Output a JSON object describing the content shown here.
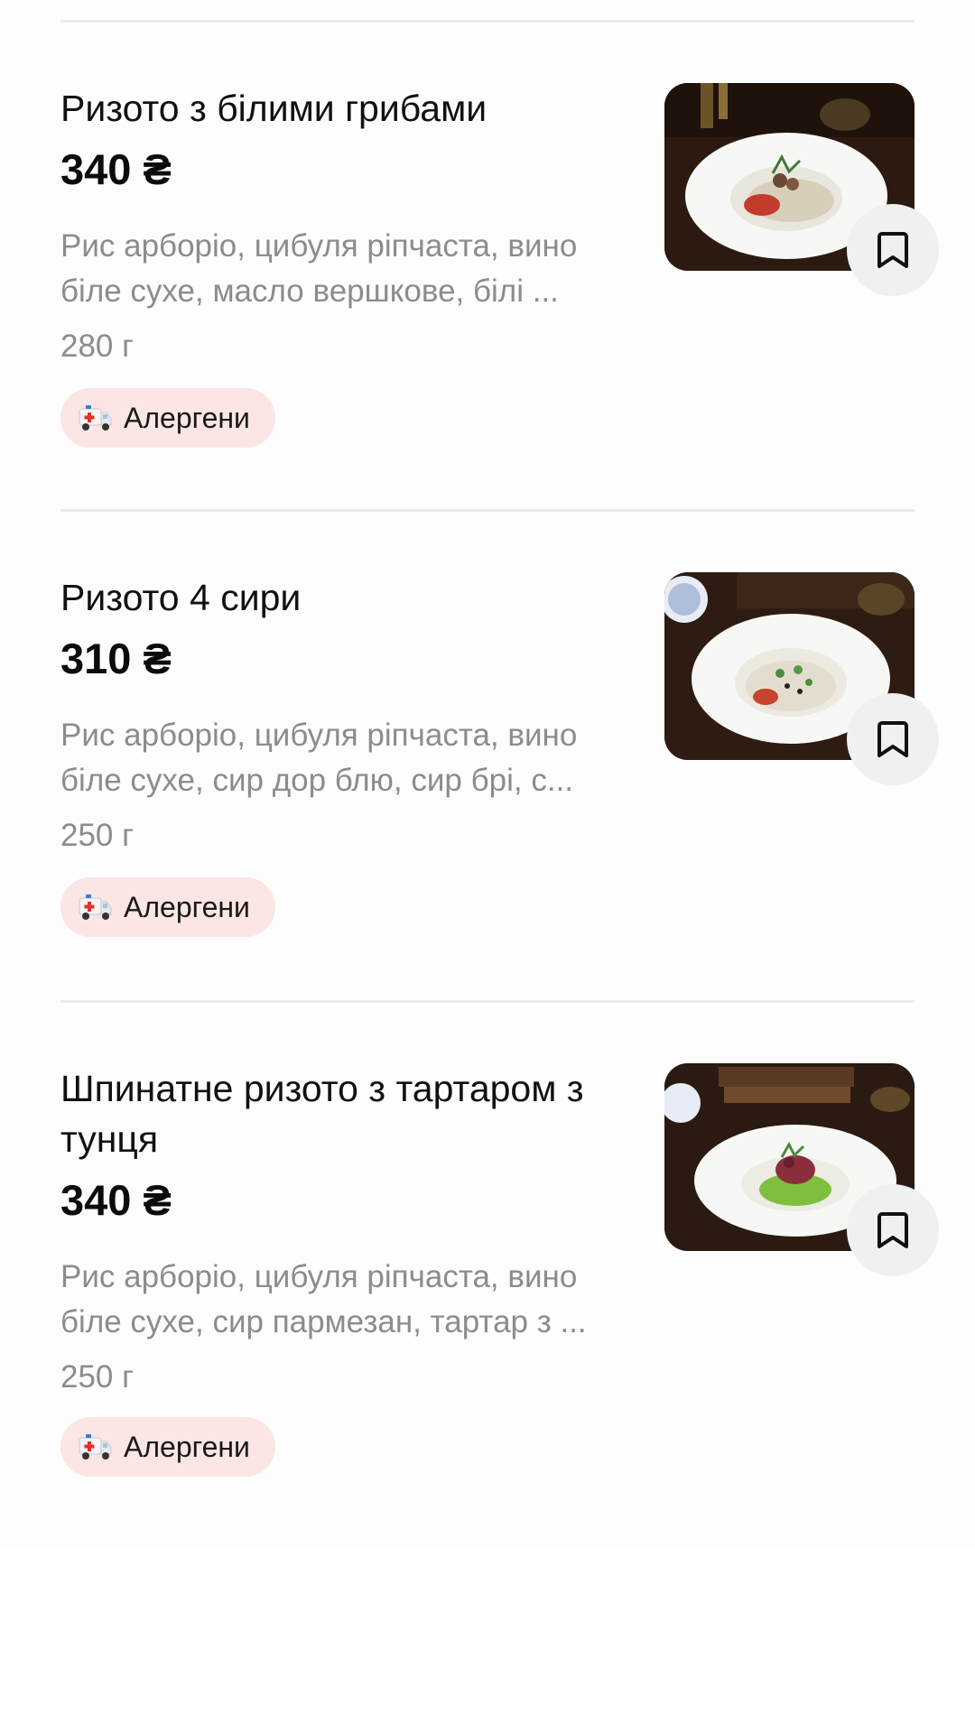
{
  "menu": {
    "items": [
      {
        "title": "Ризото з білими грибами",
        "price": "340 ₴",
        "description": "Рис арборіо, цибуля ріпчаста, вино біле сухе, масло вершкове, білі ...",
        "weight": "280 г",
        "allergens_label": "Алергени",
        "image_icon": "risotto-mushrooms-photo",
        "bookmark_icon": "bookmark-icon"
      },
      {
        "title": "Ризото 4 сири",
        "price": "310 ₴",
        "description": "Рис арборіо, цибуля ріпчаста, вино біле сухе, сир дор блю, сир брі, с...",
        "weight": "250 г",
        "allergens_label": "Алергени",
        "image_icon": "risotto-four-cheese-photo",
        "bookmark_icon": "bookmark-icon"
      },
      {
        "title": "Шпинатне ризото з тартаром з тунця",
        "price": "340 ₴",
        "description": "Рис арборіо, цибуля ріпчаста, вино біле сухе, сир пармезан, тартар з ...",
        "weight": "250 г",
        "allergens_label": "Алергени",
        "image_icon": "spinach-risotto-tuna-photo",
        "bookmark_icon": "bookmark-icon"
      }
    ]
  },
  "colors": {
    "price": "#0b0b0b",
    "secondary_text": "#8c8c8c",
    "allergen_chip_bg": "#fbe5e5",
    "bookmark_bg": "#f0f0f0"
  }
}
